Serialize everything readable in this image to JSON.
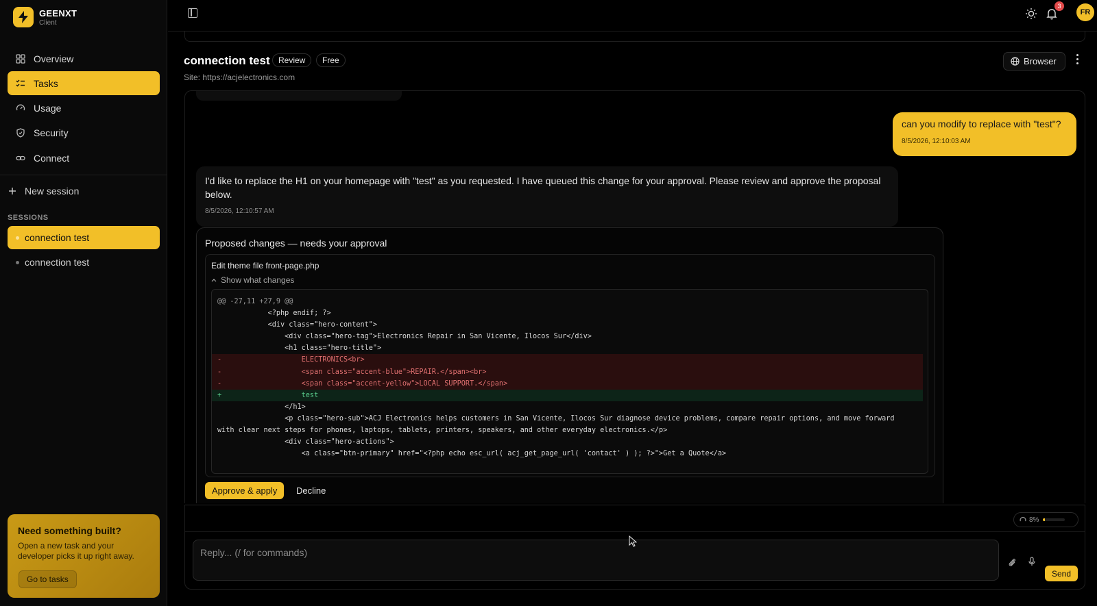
{
  "brand": {
    "name": "GEENXT",
    "sub": "Client"
  },
  "sidebar": {
    "nav": [
      {
        "label": "Overview",
        "icon": "grid-icon",
        "active": false
      },
      {
        "label": "Tasks",
        "icon": "checklist-icon",
        "active": true
      },
      {
        "label": "Usage",
        "icon": "gauge-icon",
        "active": false
      },
      {
        "label": "Security",
        "icon": "shield-icon",
        "active": false
      },
      {
        "label": "Connect",
        "icon": "link-icon",
        "active": false
      }
    ],
    "new_session": "New session",
    "sessions_label": "SESSIONS",
    "sessions": [
      {
        "label": "connection test",
        "active": true
      },
      {
        "label": "connection test",
        "active": false
      }
    ],
    "promo": {
      "title": "Need something built?",
      "text": "Open a new task and your developer picks it up right away.",
      "button": "Go to tasks"
    }
  },
  "topbar": {
    "notification_count": "3",
    "avatar_initials": "FR"
  },
  "task": {
    "title": "connection test",
    "chips": [
      "Review",
      "Free"
    ],
    "site": "Site: https://acjelectronics.com",
    "browser_button": "Browser"
  },
  "chat": {
    "user_message": {
      "text": "can you modify to replace with \"test\"?",
      "timestamp": "8/5/2026, 12:10:03 AM"
    },
    "assistant_message": {
      "text": "I'd like to replace the H1 on your homepage with \"test\" as you requested. I have queued this change for your approval. Please review and approve the proposal below.",
      "timestamp": "8/5/2026, 12:10:57 AM"
    },
    "proposal": {
      "title": "Proposed changes — needs your approval",
      "edit_title": "Edit theme file front-page.php",
      "show_changes": "Show what changes",
      "diff": [
        {
          "type": "hunk",
          "text": "@@ -27,11 +27,9 @@"
        },
        {
          "type": "ctx",
          "text": "            <?php endif; ?>"
        },
        {
          "type": "ctx",
          "text": "            <div class=\"hero-content\">"
        },
        {
          "type": "ctx",
          "text": "                <div class=\"hero-tag\">Electronics Repair in San Vicente, Ilocos Sur</div>"
        },
        {
          "type": "ctx",
          "text": "                <h1 class=\"hero-title\">"
        },
        {
          "type": "del",
          "text": "-                   ELECTRONICS<br>"
        },
        {
          "type": "del",
          "text": "-                   <span class=\"accent-blue\">REPAIR.</span><br>"
        },
        {
          "type": "del",
          "text": "-                   <span class=\"accent-yellow\">LOCAL SUPPORT.</span>"
        },
        {
          "type": "add",
          "text": "+                   test"
        },
        {
          "type": "ctx",
          "text": "                </h1>"
        },
        {
          "type": "ctx",
          "text": "                <p class=\"hero-sub\">ACJ Electronics helps customers in San Vicente, Ilocos Sur diagnose device problems, compare repair options, and move forward"
        },
        {
          "type": "ctx",
          "text": "with clear next steps for phones, laptops, tablets, printers, speakers, and other everyday electronics.</p>"
        },
        {
          "type": "ctx",
          "text": "                <div class=\"hero-actions\">"
        },
        {
          "type": "ctx",
          "text": "                    <a class=\"btn-primary\" href=\"<?php echo esc_url( acj_get_page_url( 'contact' ) ); ?>\">Get a Quote</a>"
        }
      ],
      "approve_button": "Approve & apply",
      "decline_button": "Decline"
    }
  },
  "composer": {
    "usage_text": "8%",
    "usage_fraction": 0.08,
    "placeholder": "Reply... (/ for commands)",
    "send_button": "Send"
  },
  "colors": {
    "accent": "#f2bf28",
    "background": "#000000",
    "deletion": "#e07070",
    "addition": "#58c98a"
  }
}
